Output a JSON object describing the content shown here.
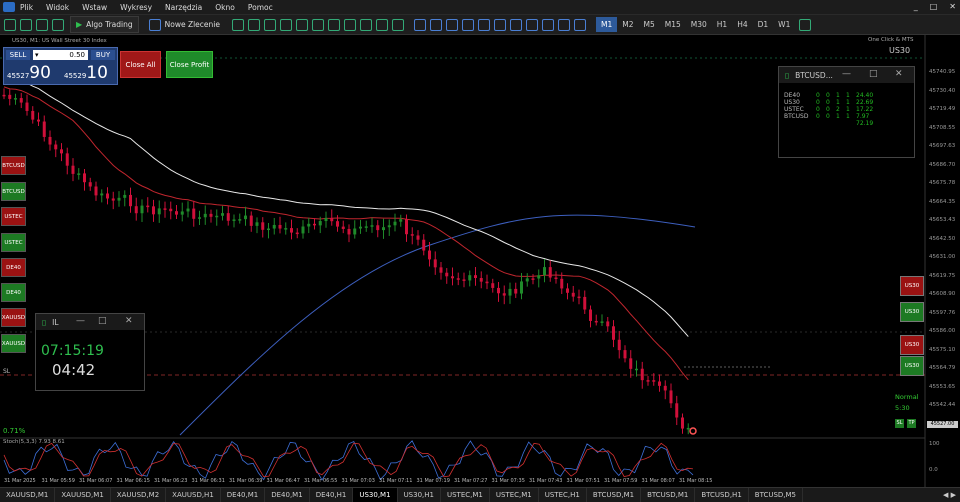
{
  "menu": {
    "items": [
      "Plik",
      "Widok",
      "Wstaw",
      "Wykresy",
      "Narzędzia",
      "Okno",
      "Pomoc"
    ],
    "window_controls": [
      "_",
      "□",
      "✕"
    ]
  },
  "toolbar": {
    "algo_label": "Algo Trading",
    "order_label": "Nowe Zlecenie",
    "timeframes": [
      "M1",
      "M2",
      "M5",
      "M15",
      "M30",
      "H1",
      "H4",
      "D1",
      "W1"
    ],
    "active_tf": "M1"
  },
  "chart": {
    "header": "US30, M1:  US Wall Street 30 Index",
    "top_right_text": "One Click & MTS",
    "symbol": "US30",
    "price_scale": [
      "45740.95",
      "45730.40",
      "45719.49",
      "45708.55",
      "45697.63",
      "45686.70",
      "45675.78",
      "45664.35",
      "45653.43",
      "45642.50",
      "45631.00",
      "45619.75",
      "45608.90",
      "45597.76",
      "45586.00",
      "45575.10",
      "45564.79",
      "45553.65",
      "45542.44",
      "45531.55",
      "45527.00"
    ],
    "current_price": "45527.00",
    "sl_label": "SL",
    "pct_label": "0.71%",
    "normal_label": "Normal",
    "spread_label": "5:30",
    "indicator_label": "Stoch(5,3,3) 7.93 8.61",
    "time_labels": [
      "31 Mar 2025",
      "31 Mar 05:59",
      "31 Mar 06:07",
      "31 Mar 06:15",
      "31 Mar 06:23",
      "31 Mar 06:31",
      "31 Mar 06:39",
      "31 Mar 06:47",
      "31 Mar 06:55",
      "31 Mar 07:03",
      "31 Mar 07:11",
      "31 Mar 07:19",
      "31 Mar 07:27",
      "31 Mar 07:35",
      "31 Mar 07:43",
      "31 Mar 07:51",
      "31 Mar 07:59",
      "31 Mar 08:07",
      "31 Mar 08:15"
    ],
    "indicator_top": "100",
    "indicator_bottom": "0.0"
  },
  "trade_panel": {
    "sell": "SELL",
    "buy": "BUY",
    "lot": "0.50",
    "bid_small": "45527",
    "bid_big": "90",
    "ask_small": "45529",
    "ask_big": "10",
    "close_all": "Close All",
    "close_profit": "Close Profit"
  },
  "left_buttons": [
    {
      "label": "BTCUSD",
      "color": "r"
    },
    {
      "label": "BTCUSD",
      "color": "g"
    },
    {
      "label": "USTEC",
      "color": "r"
    },
    {
      "label": "USTEC",
      "color": "g"
    },
    {
      "label": "DE40",
      "color": "r"
    },
    {
      "label": "DE40",
      "color": "g"
    },
    {
      "label": "XAUUSD",
      "color": "r"
    },
    {
      "label": "XAUUSD",
      "color": "g"
    }
  ],
  "right_buttons": [
    {
      "label": "US30",
      "color": "r"
    },
    {
      "label": "US30",
      "color": "g"
    },
    {
      "label": "US30",
      "color": "r"
    },
    {
      "label": "US30",
      "color": "g"
    }
  ],
  "sl_tp": {
    "sl": "SL",
    "tp": "TP"
  },
  "stats_window": {
    "title": "BTCUSD...",
    "rows": [
      {
        "sym": "DE40",
        "a": "0",
        "b": "0",
        "c": "1",
        "d": "1",
        "v": "24.40"
      },
      {
        "sym": "US30",
        "a": "0",
        "b": "0",
        "c": "1",
        "d": "1",
        "v": "22.69"
      },
      {
        "sym": "USTEC",
        "a": "0",
        "b": "0",
        "c": "2",
        "d": "1",
        "v": "17.22"
      },
      {
        "sym": "BTCUSD",
        "a": "0",
        "b": "0",
        "c": "1",
        "d": "1",
        "v": "7.97"
      }
    ],
    "total": "72.19"
  },
  "clock_window": {
    "title": "IL",
    "time": "07:15:19",
    "countdown": "04:42"
  },
  "tabs": {
    "items": [
      "XAUUSD,M1",
      "XAUUSD,M1",
      "XAUUSD,M2",
      "XAUUSD,H1",
      "DE40,M1",
      "DE40,M1",
      "DE40,H1",
      "US30,M1",
      "US30,H1",
      "USTEC,M1",
      "USTEC,M1",
      "USTEC,H1",
      "BTCUSD,M1",
      "BTCUSD,M1",
      "BTCUSD,H1",
      "BTCUSD,M5"
    ],
    "active_index": 7
  },
  "colors": {
    "bull": "#1f8a2a",
    "bear": "#d0103a",
    "ma_red": "#c0262e",
    "ma_white": "#e8e8e8",
    "ma_blue": "#3d5fbf"
  }
}
